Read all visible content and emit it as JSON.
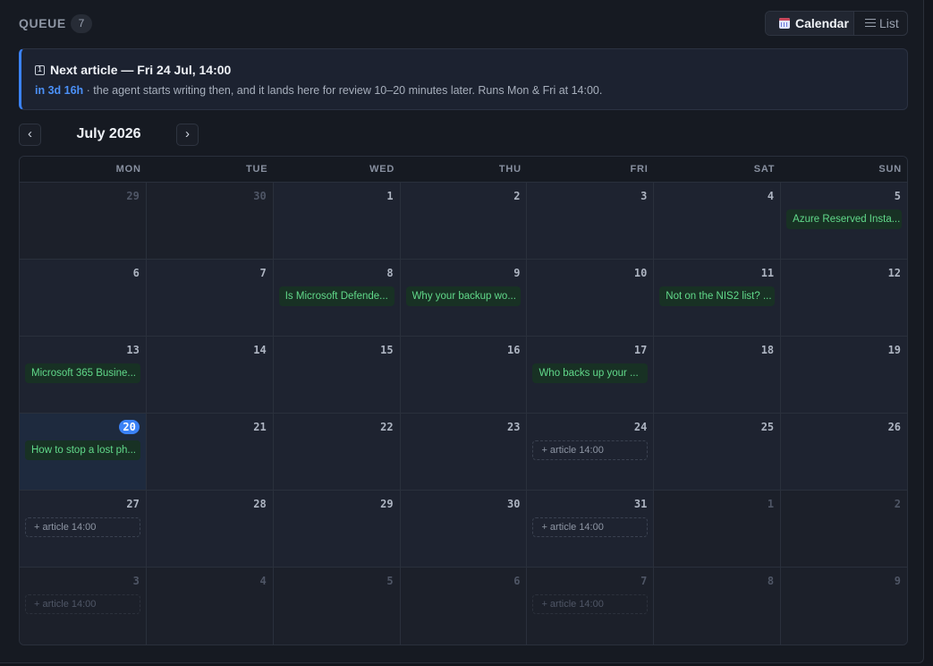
{
  "header": {
    "title": "QUEUE",
    "count": "7",
    "view_calendar": "Calendar",
    "view_list": "List"
  },
  "banner": {
    "title": "Next article — Fri 24 Jul, 14:00",
    "countdown": "in 3d 16h",
    "description": " · the agent starts writing then, and it lands here for review 10–20 minutes later. Runs Mon & Fri at 14:00."
  },
  "nav": {
    "prev": "‹",
    "next": "›",
    "month": "July 2026"
  },
  "weekdays": [
    "MON",
    "TUE",
    "WED",
    "THU",
    "FRI",
    "SAT",
    "SUN"
  ],
  "weeks": [
    [
      {
        "n": "29",
        "other": true
      },
      {
        "n": "30",
        "other": true
      },
      {
        "n": "1"
      },
      {
        "n": "2"
      },
      {
        "n": "3"
      },
      {
        "n": "4"
      },
      {
        "n": "5",
        "event": "Azure Reserved Insta..."
      }
    ],
    [
      {
        "n": "6"
      },
      {
        "n": "7"
      },
      {
        "n": "8",
        "event": "Is Microsoft Defende..."
      },
      {
        "n": "9",
        "event": "Why your backup wo..."
      },
      {
        "n": "10"
      },
      {
        "n": "11",
        "event": "Not on the NIS2 list? ..."
      },
      {
        "n": "12"
      }
    ],
    [
      {
        "n": "13",
        "event": "Microsoft 365 Busine..."
      },
      {
        "n": "14"
      },
      {
        "n": "15"
      },
      {
        "n": "16"
      },
      {
        "n": "17",
        "event": "Who backs up your ..."
      },
      {
        "n": "18"
      },
      {
        "n": "19"
      }
    ],
    [
      {
        "n": "20",
        "today": true,
        "event": "How to stop a lost ph..."
      },
      {
        "n": "21"
      },
      {
        "n": "22"
      },
      {
        "n": "23"
      },
      {
        "n": "24",
        "slot": "+ article 14:00"
      },
      {
        "n": "25"
      },
      {
        "n": "26"
      }
    ],
    [
      {
        "n": "27",
        "slot": "+ article 14:00"
      },
      {
        "n": "28"
      },
      {
        "n": "29"
      },
      {
        "n": "30"
      },
      {
        "n": "31",
        "slot": "+ article 14:00"
      },
      {
        "n": "1",
        "other": true
      },
      {
        "n": "2",
        "other": true
      }
    ],
    [
      {
        "n": "3",
        "other": true,
        "slot": "+ article 14:00"
      },
      {
        "n": "4",
        "other": true
      },
      {
        "n": "5",
        "other": true
      },
      {
        "n": "6",
        "other": true
      },
      {
        "n": "7",
        "other": true,
        "slot": "+ article 14:00"
      },
      {
        "n": "8",
        "other": true
      },
      {
        "n": "9",
        "other": true
      }
    ]
  ]
}
